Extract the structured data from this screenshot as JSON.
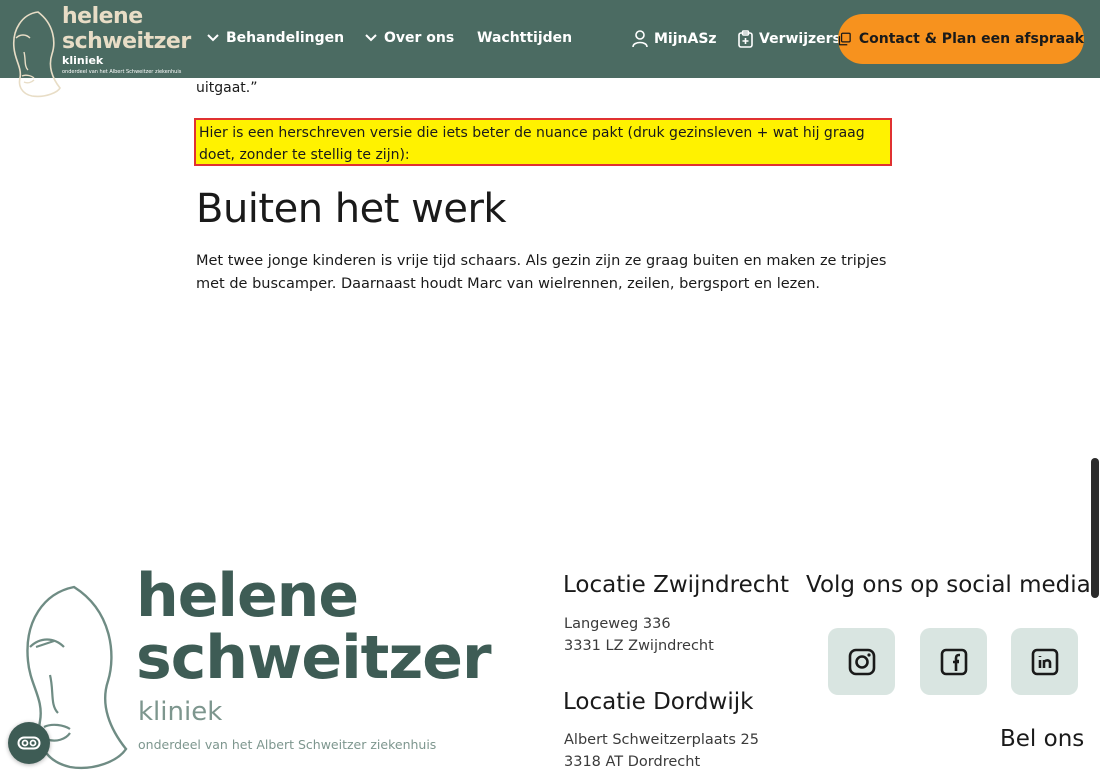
{
  "header": {
    "logo": {
      "line1": "helene",
      "line2": "schweitzer",
      "kliniek": "kliniek",
      "sub": "onderdeel van het Albert Schweitzer ziekenhuis"
    },
    "nav": [
      {
        "label": "Behandelingen",
        "has_dropdown": true
      },
      {
        "label": "Over ons",
        "has_dropdown": true
      },
      {
        "label": "Wachttijden",
        "has_dropdown": false
      },
      {
        "label": "MijnASz",
        "icon": "user-icon"
      },
      {
        "label": "Verwijzers",
        "icon": "clipboard-icon"
      }
    ],
    "cta": {
      "label": "Contact & Plan een afspraak",
      "icon": "calendar-copy-icon"
    },
    "colors": {
      "bar": "#4b6b62",
      "cta": "#f7921e",
      "logo_text": "#e8ddc6"
    }
  },
  "content": {
    "quote_end": "uitgaat.”",
    "highlight": "Hier is een herschreven versie die iets beter de nuance pakt (druk gezinsleven + wat hij graag doet, zonder te stellig te zijn):",
    "heading": "Buiten het werk",
    "paragraph": "Met twee jonge kinderen is vrije tijd schaars. Als gezin zijn ze graag buiten en maken ze tripjes met de buscamper. Daarnaast houdt Marc van wielrennen, zeilen, bergsport en lezen."
  },
  "footer": {
    "logo": {
      "line1": "helene",
      "line2": "schweitzer",
      "kliniek": "kliniek",
      "sub": "onderdeel van het Albert Schweitzer ziekenhuis"
    },
    "locations": [
      {
        "title": "Locatie Zwijndrecht",
        "street": "Langeweg 336",
        "city": "3331 LZ Zwijndrecht"
      },
      {
        "title": "Locatie Dordwijk",
        "street": "Albert Schweitzerplaats 25",
        "city": "3318 AT Dordrecht"
      }
    ],
    "social_title": "Volg ons op social media!",
    "social": [
      "instagram-icon",
      "facebook-icon",
      "linkedin-icon"
    ],
    "bel_ons": "Bel ons"
  },
  "accessibility_button": {
    "icon": "accessibility-icon"
  }
}
